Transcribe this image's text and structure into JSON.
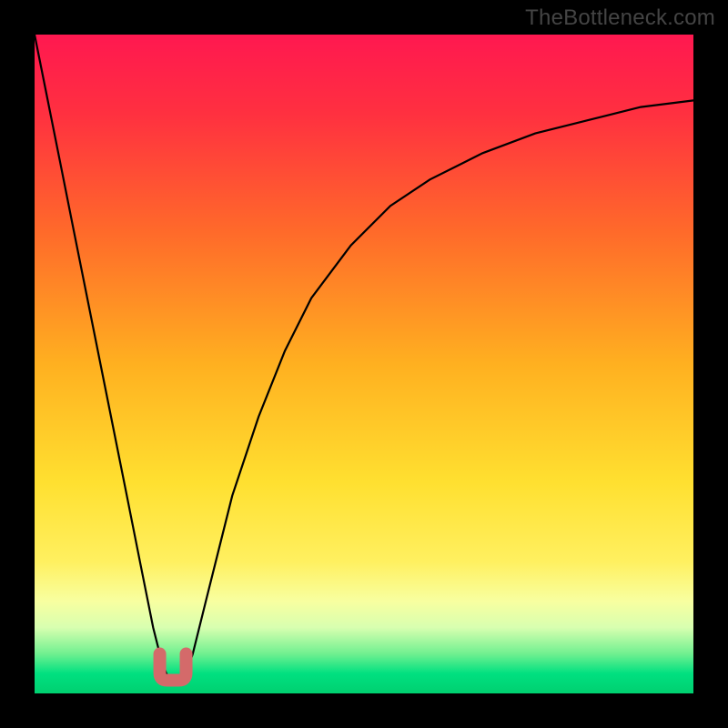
{
  "watermark": "TheBottleneck.com",
  "colors": {
    "frame": "#000000",
    "curve": "#000000",
    "marker": "#d46a6a",
    "gradient_stops": [
      {
        "pct": 0,
        "color": "#ff1850"
      },
      {
        "pct": 12,
        "color": "#ff3040"
      },
      {
        "pct": 30,
        "color": "#ff6a2a"
      },
      {
        "pct": 50,
        "color": "#ffb020"
      },
      {
        "pct": 68,
        "color": "#ffe030"
      },
      {
        "pct": 80,
        "color": "#fff060"
      },
      {
        "pct": 86,
        "color": "#f8ffa0"
      },
      {
        "pct": 90,
        "color": "#d8ffb0"
      },
      {
        "pct": 94,
        "color": "#70f090"
      },
      {
        "pct": 97,
        "color": "#00e080"
      },
      {
        "pct": 100,
        "color": "#00d070"
      }
    ]
  },
  "chart_data": {
    "type": "line",
    "title": "",
    "xlabel": "",
    "ylabel": "",
    "xlim": [
      0,
      100
    ],
    "ylim": [
      0,
      100
    ],
    "series": [
      {
        "name": "bottleneck-curve",
        "x": [
          0,
          2,
          4,
          6,
          8,
          10,
          12,
          14,
          16,
          18,
          19,
          20,
          21,
          22,
          23,
          24,
          26,
          28,
          30,
          34,
          38,
          42,
          48,
          54,
          60,
          68,
          76,
          84,
          92,
          100
        ],
        "values": [
          100,
          90,
          80,
          70,
          60,
          50,
          40,
          30,
          20,
          10,
          6,
          3,
          2,
          2,
          3,
          6,
          14,
          22,
          30,
          42,
          52,
          60,
          68,
          74,
          78,
          82,
          85,
          87,
          89,
          90
        ]
      }
    ],
    "annotations": [
      {
        "name": "optimal-region",
        "shape": "u-marker",
        "x_range": [
          19,
          23
        ],
        "y_range": [
          2,
          6
        ]
      }
    ]
  }
}
